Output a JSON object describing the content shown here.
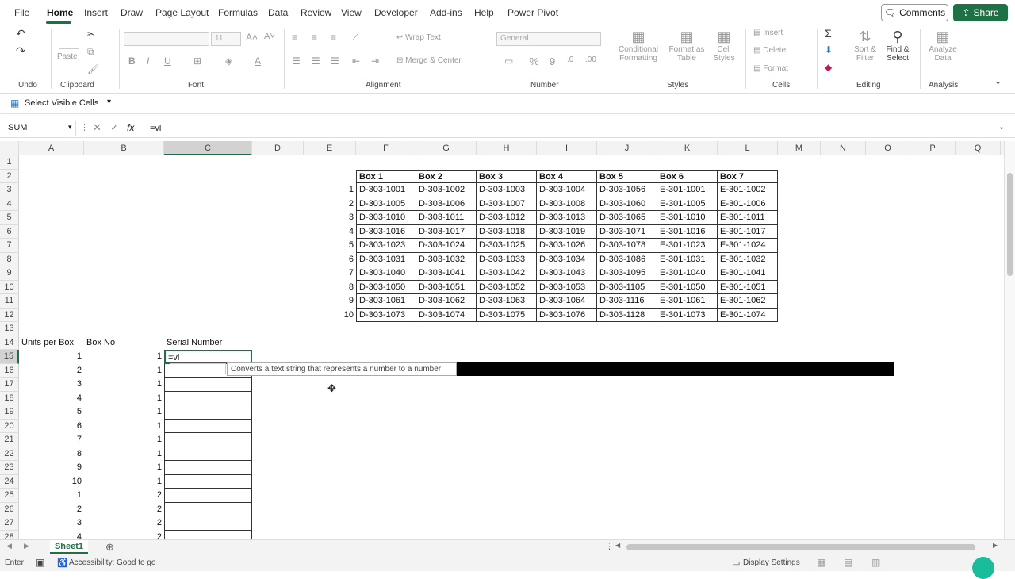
{
  "menu": {
    "items": [
      "File",
      "Home",
      "Insert",
      "Draw",
      "Page Layout",
      "Formulas",
      "Data",
      "Review",
      "View",
      "Developer",
      "Add-ins",
      "Help",
      "Power Pivot"
    ],
    "comments": "Comments",
    "share": "Share"
  },
  "ribbon": {
    "undo_label": "Undo",
    "clipboard_label": "Clipboard",
    "paste": "Paste",
    "font_label": "Font",
    "font_size": "11",
    "alignment_label": "Alignment",
    "wrap_text": "Wrap Text",
    "merge_center": "Merge & Center",
    "number_label": "Number",
    "number_format": "General",
    "styles_label": "Styles",
    "conditional_formatting": "Conditional Formatting",
    "format_as_table": "Format as Table",
    "cell_styles": "Cell Styles",
    "cells_label": "Cells",
    "insert": "Insert",
    "delete": "Delete",
    "format": "Format",
    "editing_label": "Editing",
    "sort_filter": "Sort & Filter",
    "find_select": "Find & Select",
    "analysis_label": "Analysis",
    "analyze_data": "Analyze Data"
  },
  "quick_access": {
    "select_visible_cells": "Select Visible Cells"
  },
  "formula_bar": {
    "name_box": "SUM",
    "fx": "fx",
    "formula": "=vl"
  },
  "columns": [
    "A",
    "B",
    "C",
    "D",
    "E",
    "F",
    "G",
    "H",
    "I",
    "J",
    "K",
    "L",
    "M",
    "N",
    "O",
    "P",
    "Q"
  ],
  "rows": [
    "1",
    "2",
    "3",
    "4",
    "5",
    "6",
    "7",
    "8",
    "9",
    "10",
    "11",
    "12",
    "13",
    "14",
    "15",
    "16",
    "17",
    "18",
    "19",
    "20",
    "21",
    "22",
    "23",
    "24",
    "25",
    "26",
    "27",
    "28"
  ],
  "box_table": {
    "headers": [
      "Box 1",
      "Box 2",
      "Box 3",
      "Box 4",
      "Box 5",
      "Box 6",
      "Box 7"
    ],
    "index": [
      "1",
      "2",
      "3",
      "4",
      "5",
      "6",
      "7",
      "8",
      "9",
      "10"
    ],
    "rows": [
      [
        "D-303-1001",
        "D-303-1002",
        "D-303-1003",
        "D-303-1004",
        "D-303-1056",
        "E-301-1001",
        "E-301-1002"
      ],
      [
        "D-303-1005",
        "D-303-1006",
        "D-303-1007",
        "D-303-1008",
        "D-303-1060",
        "E-301-1005",
        "E-301-1006"
      ],
      [
        "D-303-1010",
        "D-303-1011",
        "D-303-1012",
        "D-303-1013",
        "D-303-1065",
        "E-301-1010",
        "E-301-1011"
      ],
      [
        "D-303-1016",
        "D-303-1017",
        "D-303-1018",
        "D-303-1019",
        "D-303-1071",
        "E-301-1016",
        "E-301-1017"
      ],
      [
        "D-303-1023",
        "D-303-1024",
        "D-303-1025",
        "D-303-1026",
        "D-303-1078",
        "E-301-1023",
        "E-301-1024"
      ],
      [
        "D-303-1031",
        "D-303-1032",
        "D-303-1033",
        "D-303-1034",
        "D-303-1086",
        "E-301-1031",
        "E-301-1032"
      ],
      [
        "D-303-1040",
        "D-303-1041",
        "D-303-1042",
        "D-303-1043",
        "D-303-1095",
        "E-301-1040",
        "E-301-1041"
      ],
      [
        "D-303-1050",
        "D-303-1051",
        "D-303-1052",
        "D-303-1053",
        "D-303-1105",
        "E-301-1050",
        "E-301-1051"
      ],
      [
        "D-303-1061",
        "D-303-1062",
        "D-303-1063",
        "D-303-1064",
        "D-303-1116",
        "E-301-1061",
        "E-301-1062"
      ],
      [
        "D-303-1073",
        "D-303-1074",
        "D-303-1075",
        "D-303-1076",
        "D-303-1128",
        "E-301-1073",
        "E-301-1074"
      ]
    ]
  },
  "units_table": {
    "headers": [
      "Units per Box",
      "Box No",
      "Serial Number"
    ],
    "units": [
      "1",
      "2",
      "3",
      "4",
      "5",
      "6",
      "7",
      "8",
      "9",
      "10",
      "1",
      "2",
      "3",
      "4"
    ],
    "box_no": [
      "1",
      "1",
      "1",
      "1",
      "1",
      "1",
      "1",
      "1",
      "1",
      "1",
      "2",
      "2",
      "2",
      "2"
    ],
    "editing_value": "=vl"
  },
  "tooltip": "Converts a text string that represents a number to a number",
  "sheet_tab": "Sheet1",
  "status": {
    "mode": "Enter",
    "accessibility": "Accessibility: Good to go",
    "display_settings": "Display Settings"
  }
}
